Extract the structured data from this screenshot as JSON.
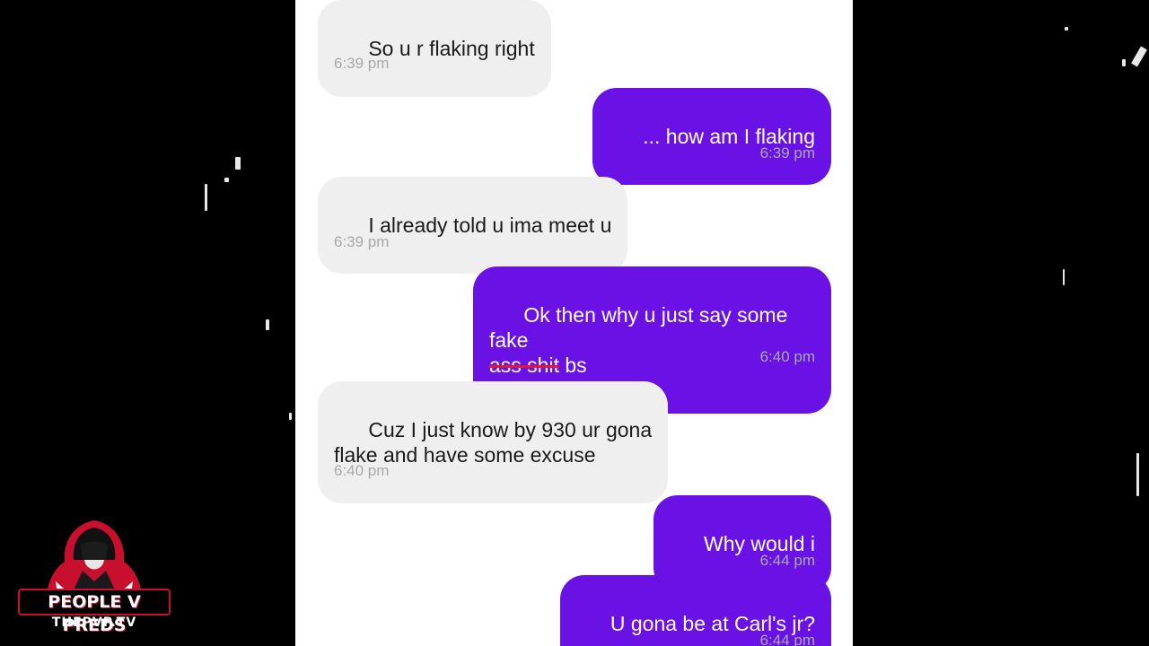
{
  "messages": [
    {
      "direction": "in",
      "text": "So u r flaking right",
      "time": "6:39 pm"
    },
    {
      "direction": "out",
      "text": "... how am I flaking",
      "time": "6:39 pm"
    },
    {
      "direction": "in",
      "text": "I already told u ima meet u",
      "time": "6:39 pm"
    },
    {
      "direction": "out",
      "text_line1": "Ok then why u just say some fake",
      "text_struck": "ass shit",
      "text_after": " bs",
      "time": "6:40 pm"
    },
    {
      "direction": "in",
      "text": "Cuz I just know by 930 ur gona\nflake and have some excuse",
      "time": "6:40 pm"
    },
    {
      "direction": "out",
      "text": "Why would i",
      "time": "6:44 pm"
    },
    {
      "direction": "out",
      "text": "U gona be at Carl's jr?",
      "time": "6:44 pm"
    }
  ],
  "watermark": {
    "title": "PEOPLE V PREDS",
    "subtitle": "THEPVP.TV",
    "icon": "hooded-figure-icon",
    "accent_color": "#c8102e"
  },
  "colors": {
    "incoming_bubble": "#efefef",
    "outgoing_bubble": "#6a12e6",
    "timestamp": "#a9a9a9",
    "background": "#000000"
  }
}
